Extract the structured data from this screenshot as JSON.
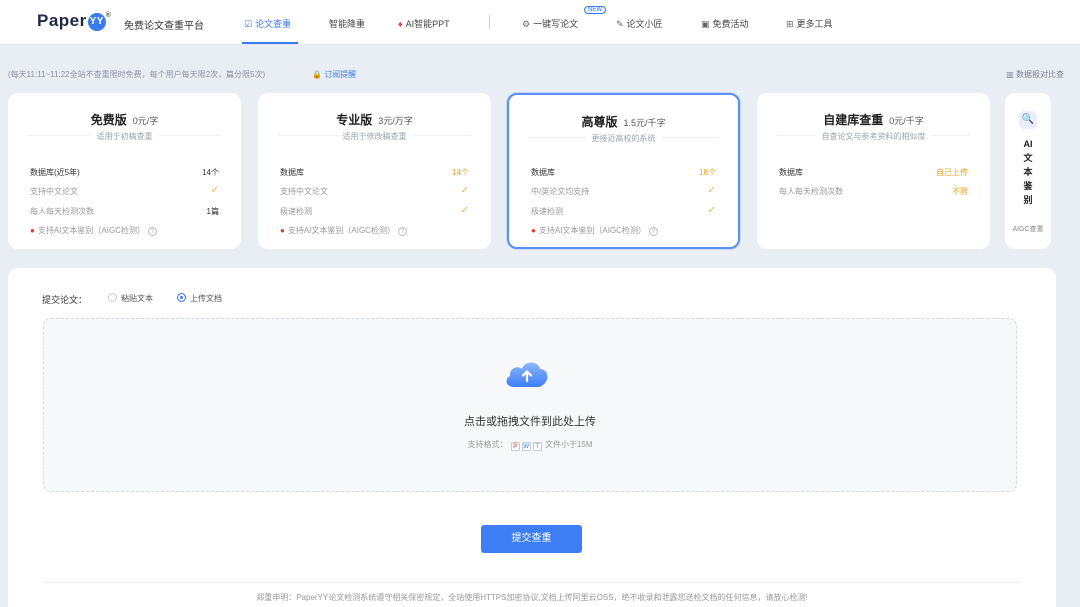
{
  "header": {
    "logo_text": "Paper",
    "logo_badge": "YY",
    "logo_reg": "®",
    "slogan": "免费论文查重平台",
    "nav": [
      {
        "label": "论文查重",
        "icon": "☑"
      },
      {
        "label": "智能降重",
        "icon": ""
      },
      {
        "label": "AI智能PPT",
        "icon": "♦"
      },
      {
        "label": "一键写论文",
        "icon": "⚙"
      },
      {
        "label": "论文小匠",
        "icon": "✎"
      },
      {
        "label": "免费活动",
        "icon": "▣"
      },
      {
        "label": "更多工具",
        "icon": "⊞"
      }
    ],
    "new_badge": "NEW"
  },
  "notice": {
    "text": "(每天11:11~11:22全站不查重限时免费，每个用户每天限2次，篇分限5次)",
    "link": "订阅提醒",
    "report": "数据报对比查"
  },
  "plans": [
    {
      "name": "免费版",
      "price": "0元/字",
      "sub": "适用于初稿查重",
      "rows": [
        {
          "label": "数据库(近5年)",
          "val": "14个",
          "style": "dark"
        },
        {
          "label": "支持中文论文",
          "check": true
        },
        {
          "label": "每人每天检测次数",
          "val": "1篇",
          "style": "dark"
        },
        {
          "label": "支持AI文本鉴别（AIGC检测）",
          "fire": true
        }
      ]
    },
    {
      "name": "专业版",
      "price": "3元/万字",
      "sub": "适用于修改稿查重",
      "rows": [
        {
          "label": "数据库",
          "val": "14个",
          "style": "orange"
        },
        {
          "label": "支持中文论文",
          "check": true
        },
        {
          "label": "极速检测",
          "check": true
        },
        {
          "label": "支持AI文本鉴别（AIGC检测）",
          "fire": true
        }
      ]
    },
    {
      "name": "高尊版",
      "price": "1.5元/千字",
      "sub": "更接近高校的系统",
      "rows": [
        {
          "label": "数据库",
          "val": "18个",
          "style": "orange"
        },
        {
          "label": "中/英论文均支持",
          "check": true
        },
        {
          "label": "极速检测",
          "check": true
        },
        {
          "label": "支持AI文本鉴别（AIGC检测）",
          "fire": true
        }
      ]
    },
    {
      "name": "自建库查重",
      "price": "0元/千字",
      "sub": "自查论文与参考资料的相似度",
      "rows": [
        {
          "label": "数据库",
          "val": "自己上传",
          "style": "orange"
        },
        {
          "label": "每人每天检测次数",
          "val": "不限",
          "style": "orange"
        }
      ]
    }
  ],
  "side": {
    "icon": "🔍",
    "title": "AI文本鉴别",
    "foot": "AIGC查重"
  },
  "form": {
    "label": "提交论文：",
    "option_paste": "粘贴文本",
    "option_upload": "上传文档",
    "upload_text": "点击或拖拽文件到此处上传",
    "formats_prefix": "支持格式：",
    "formats_suffix": "文件小于15M",
    "fmt_pdf": "P",
    "fmt_word": "W",
    "fmt_txt": "T",
    "submit": "提交查重"
  },
  "disclaimer": "郑重申明：PaperYY论文检测系统遵守相关保密规定，全站使用HTTPS加密协议,文档上传阿里云OSS，绝不收录和泄露您送检文档的任何信息，请放心检测!"
}
